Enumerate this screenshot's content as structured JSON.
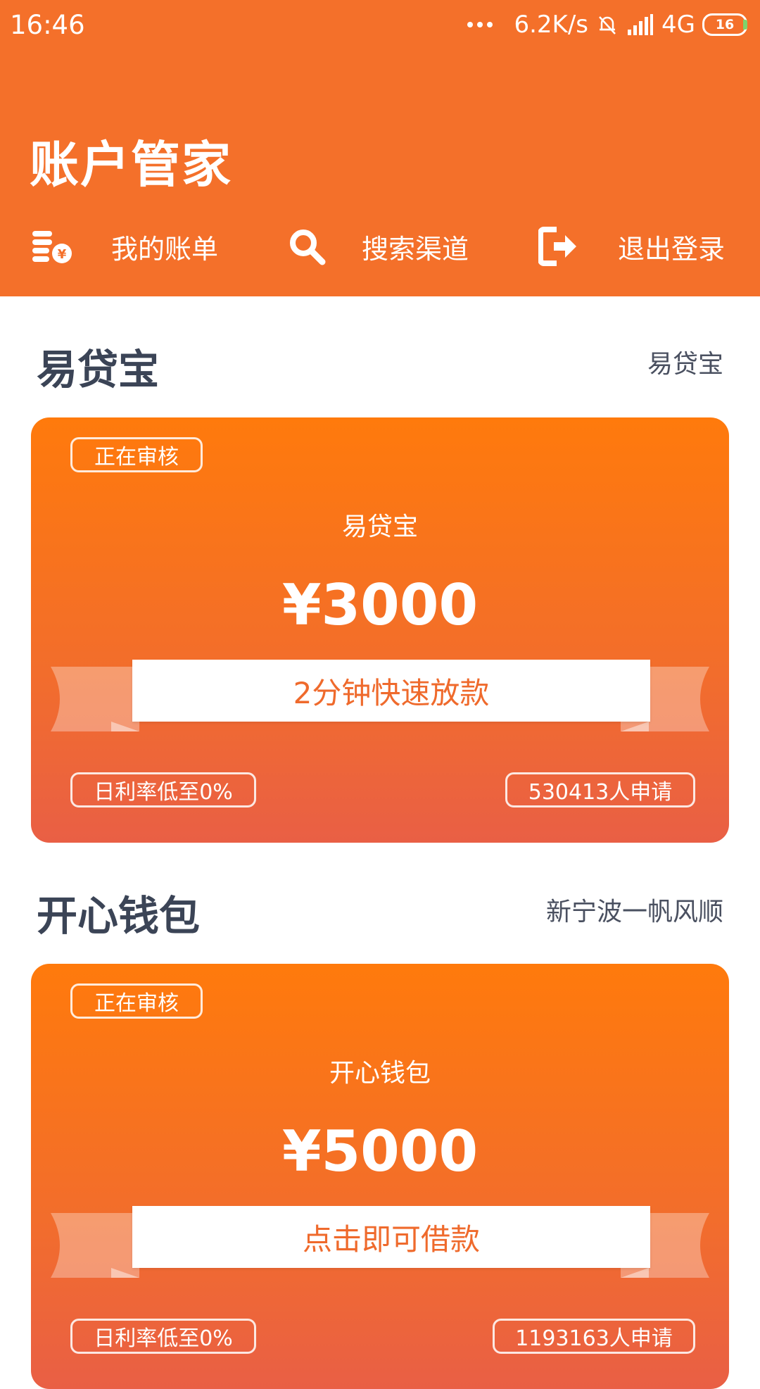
{
  "status_bar": {
    "time": "16:46",
    "net_speed": "6.2K/s",
    "network": "4G",
    "battery": "16"
  },
  "header": {
    "title": "账户管家",
    "nav": [
      {
        "label": "我的账单",
        "icon": "bills-icon"
      },
      {
        "label": "搜索渠道",
        "icon": "search-icon"
      },
      {
        "label": "退出登录",
        "icon": "logout-icon"
      }
    ]
  },
  "colors": {
    "header_bg": "#f4702a",
    "card_top": "#ff7a0c",
    "card_bottom": "#e95f45",
    "section_title": "#3b4456"
  },
  "products": [
    {
      "section_title": "易贷宝",
      "section_sub": "易贷宝",
      "status": "正在审核",
      "name": "易贷宝",
      "amount": "¥3000",
      "banner": "2分钟快速放款",
      "rate": "日利率低至0%",
      "applicants": "530413人申请"
    },
    {
      "section_title": "开心钱包",
      "section_sub": "新宁波一帆风顺",
      "status": "正在审核",
      "name": "开心钱包",
      "amount": "¥5000",
      "banner": "点击即可借款",
      "rate": "日利率低至0%",
      "applicants": "1193163人申请"
    }
  ]
}
